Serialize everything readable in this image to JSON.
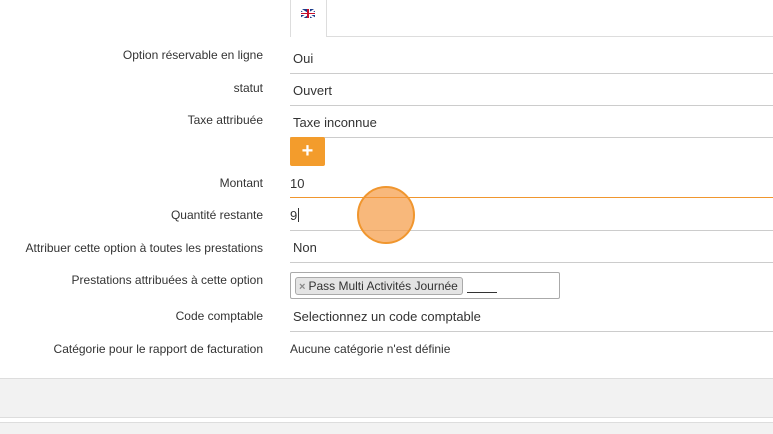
{
  "language_tab": {
    "flag": "uk-flag-icon"
  },
  "form": {
    "bookable": {
      "label": "Option réservable en ligne",
      "value": "Oui"
    },
    "status": {
      "label": "statut",
      "value": "Ouvert"
    },
    "tax": {
      "label": "Taxe attribuée",
      "value": "Taxe inconnue"
    },
    "add_button": {
      "symbol": "+",
      "icon": "plus-icon"
    },
    "amount": {
      "label": "Montant",
      "value": "10"
    },
    "remaining_qty": {
      "label": "Quantité restante",
      "value": "9"
    },
    "assign_all": {
      "label": "Attribuer cette option à toutes les prestations",
      "value": "Non"
    },
    "assigned_services": {
      "label": "Prestations attribuées à cette option",
      "tags": [
        {
          "remove": "×",
          "text": "Pass Multi Activités Journée"
        }
      ]
    },
    "accounting_code": {
      "label": "Code comptable",
      "placeholder": "Selectionnez un code comptable"
    },
    "billing_category": {
      "label": "Catégorie pour le rapport de facturation",
      "value": "Aucune catégorie n'est définie"
    }
  },
  "colors": {
    "accent": "#f39c2c",
    "focus_border": "#f0962e"
  }
}
